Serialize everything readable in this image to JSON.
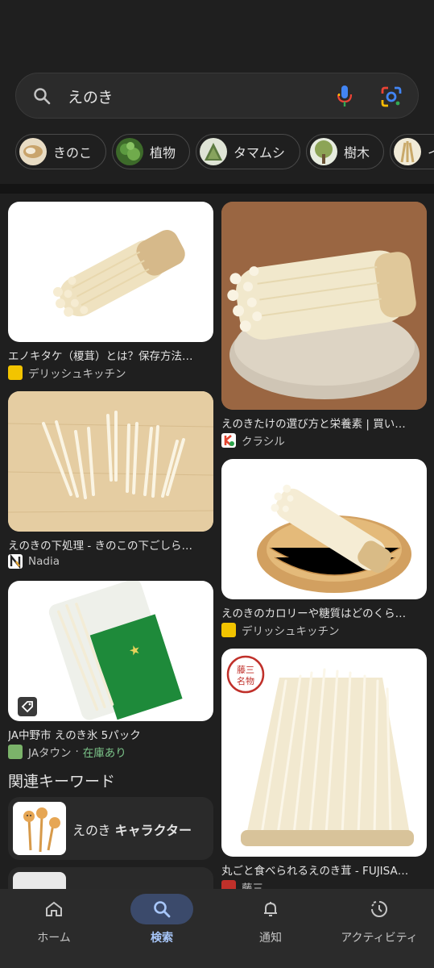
{
  "search": {
    "query": "えのき"
  },
  "chips": [
    {
      "label": "きのこ",
      "thumb_color": "#d9c4a0"
    },
    {
      "label": "植物",
      "thumb_color": "#4f7d3a"
    },
    {
      "label": "タマムシ",
      "thumb_color": "#6e8a56"
    },
    {
      "label": "樹木",
      "thumb_color": "#8aa05a"
    },
    {
      "label": "イ",
      "thumb_color": "#e4dcc4"
    }
  ],
  "results": [
    {
      "title": "エノキタケ（榎茸）とは？保存方法…",
      "source": "デリッシュキッチン",
      "fav_color": "#f2c400"
    },
    {
      "title": "えのきたけの選び方と栄養素 | 買い…",
      "source": "クラシル",
      "fav_color": "#ffffff"
    },
    {
      "title": "えのきの下処理 - きのこの下ごしら…",
      "source": "Nadia",
      "fav_color": "#ffffff"
    },
    {
      "title": "えのきのカロリーや糖質はどのくら…",
      "source": "デリッシュキッチン",
      "fav_color": "#f2c400"
    },
    {
      "title": "JA中野市 えのき氷 5パック",
      "source": "JAタウン",
      "stock": "在庫あり",
      "fav_color": "#7bb36a"
    },
    {
      "title": "丸ごと食べられるえのき茸 - FUJISA…",
      "source": "藤三",
      "fav_color": "#c0302a"
    }
  ],
  "related": {
    "heading": "関連キーワード",
    "items": [
      {
        "prefix": "えのき",
        "bold": "キャラクター"
      }
    ]
  },
  "nav": [
    {
      "label": "ホーム",
      "icon": "home-icon"
    },
    {
      "label": "検索",
      "icon": "search-icon",
      "active": true
    },
    {
      "label": "通知",
      "icon": "bell-icon"
    },
    {
      "label": "アクティビティ",
      "icon": "activity-icon"
    }
  ]
}
